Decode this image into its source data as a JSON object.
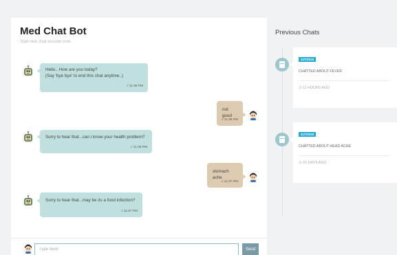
{
  "chat": {
    "title": "Med Chat Bot",
    "subtitle": "Start new chat session now.."
  },
  "messages": [
    {
      "sender": "bot",
      "line1": "Hello.. How are you today?",
      "line2": "(Say 'bye bye' to end this chat anytime..)",
      "time": "√ 11:36 PM"
    },
    {
      "sender": "user",
      "line1": "not good",
      "time": "√ 11:36 PM"
    },
    {
      "sender": "bot",
      "line1": "Sorry to hear that...can i know your health problem?",
      "time": "√ 11:36 PM"
    },
    {
      "sender": "user",
      "line1": "stomach ache",
      "time": "√ 11:37 PM"
    },
    {
      "sender": "bot",
      "line1": "Sorry to hear that...may be its a food infection?",
      "time": "√ 11:37 PM"
    }
  ],
  "composer": {
    "placeholder": "Type here!",
    "send_label": "Send"
  },
  "previous": {
    "title": "Previous Chats",
    "items": [
      {
        "date": "22/7/2019",
        "description": "CHATTED ABOUT FEVER",
        "ago": "11 HOURS AGO"
      },
      {
        "date": "21/7/2019",
        "description": "CHATTED ABOUT HEAD ACHE",
        "ago": "10 DAYS AGO"
      }
    ]
  },
  "colors": {
    "bot_bubble": "#bfe0df",
    "user_bubble": "#dccbb1",
    "date_badge": "#27a9d6",
    "send_button": "#7a9aa6",
    "timeline_icon": "#9cc8cd"
  }
}
